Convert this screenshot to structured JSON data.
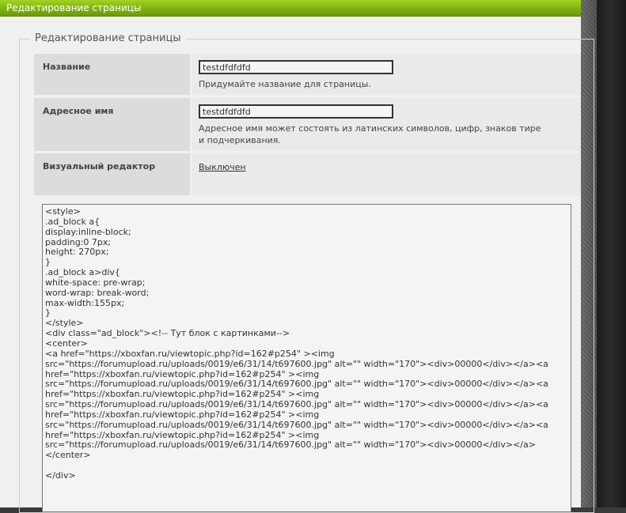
{
  "header": {
    "title": "Редактирование страницы"
  },
  "section": {
    "legend": "Редактирование страницы"
  },
  "fields": {
    "name": {
      "label": "Название",
      "value": "testdfdfdfd",
      "hint": "Придумайте название для страницы."
    },
    "address": {
      "label": "Адресное имя",
      "value": "testdfdfdfd",
      "hint": "Адресное имя может состоять из латинских символов, цифр, знаков тире и подчеркивания."
    },
    "visual_editor": {
      "label": "Визуальный редактор",
      "state": "Выключен"
    }
  },
  "editor": {
    "content": "<style>\n.ad_block a{\ndisplay:inline-block;\npadding:0 7px;\nheight: 270px;\n}\n.ad_block a>div{\nwhite-space: pre-wrap;\nword-wrap: break-word;\nmax-width:155px;\n}\n</style>\n<div class=\"ad_block\"><!-- Тут блок с картинками-->\n<center>\n<a href=\"https://xboxfan.ru/viewtopic.php?id=162#p254\" ><img\nsrc=\"https://forumupload.ru/uploads/0019/e6/31/14/t697600.jpg\" alt=\"\" width=\"170\"><div>00000</div></a><a\nhref=\"https://xboxfan.ru/viewtopic.php?id=162#p254\" ><img\nsrc=\"https://forumupload.ru/uploads/0019/e6/31/14/t697600.jpg\" alt=\"\" width=\"170\"><div>00000</div></a><a\nhref=\"https://xboxfan.ru/viewtopic.php?id=162#p254\" ><img\nsrc=\"https://forumupload.ru/uploads/0019/e6/31/14/t697600.jpg\" alt=\"\" width=\"170\"><div>00000</div></a><a\nhref=\"https://xboxfan.ru/viewtopic.php?id=162#p254\" ><img\nsrc=\"https://forumupload.ru/uploads/0019/e6/31/14/t697600.jpg\" alt=\"\" width=\"170\"><div>00000</div></a><a\nhref=\"https://xboxfan.ru/viewtopic.php?id=162#p254\" ><img\nsrc=\"https://forumupload.ru/uploads/0019/e6/31/14/t697600.jpg\" alt=\"\" width=\"170\"><div>00000</div></a>\n</center>\n\n</div>"
  },
  "colors": {
    "header_green": "#7fb10f",
    "label_bg": "#dcdcdc",
    "page_bg": "#f0f0f0"
  }
}
